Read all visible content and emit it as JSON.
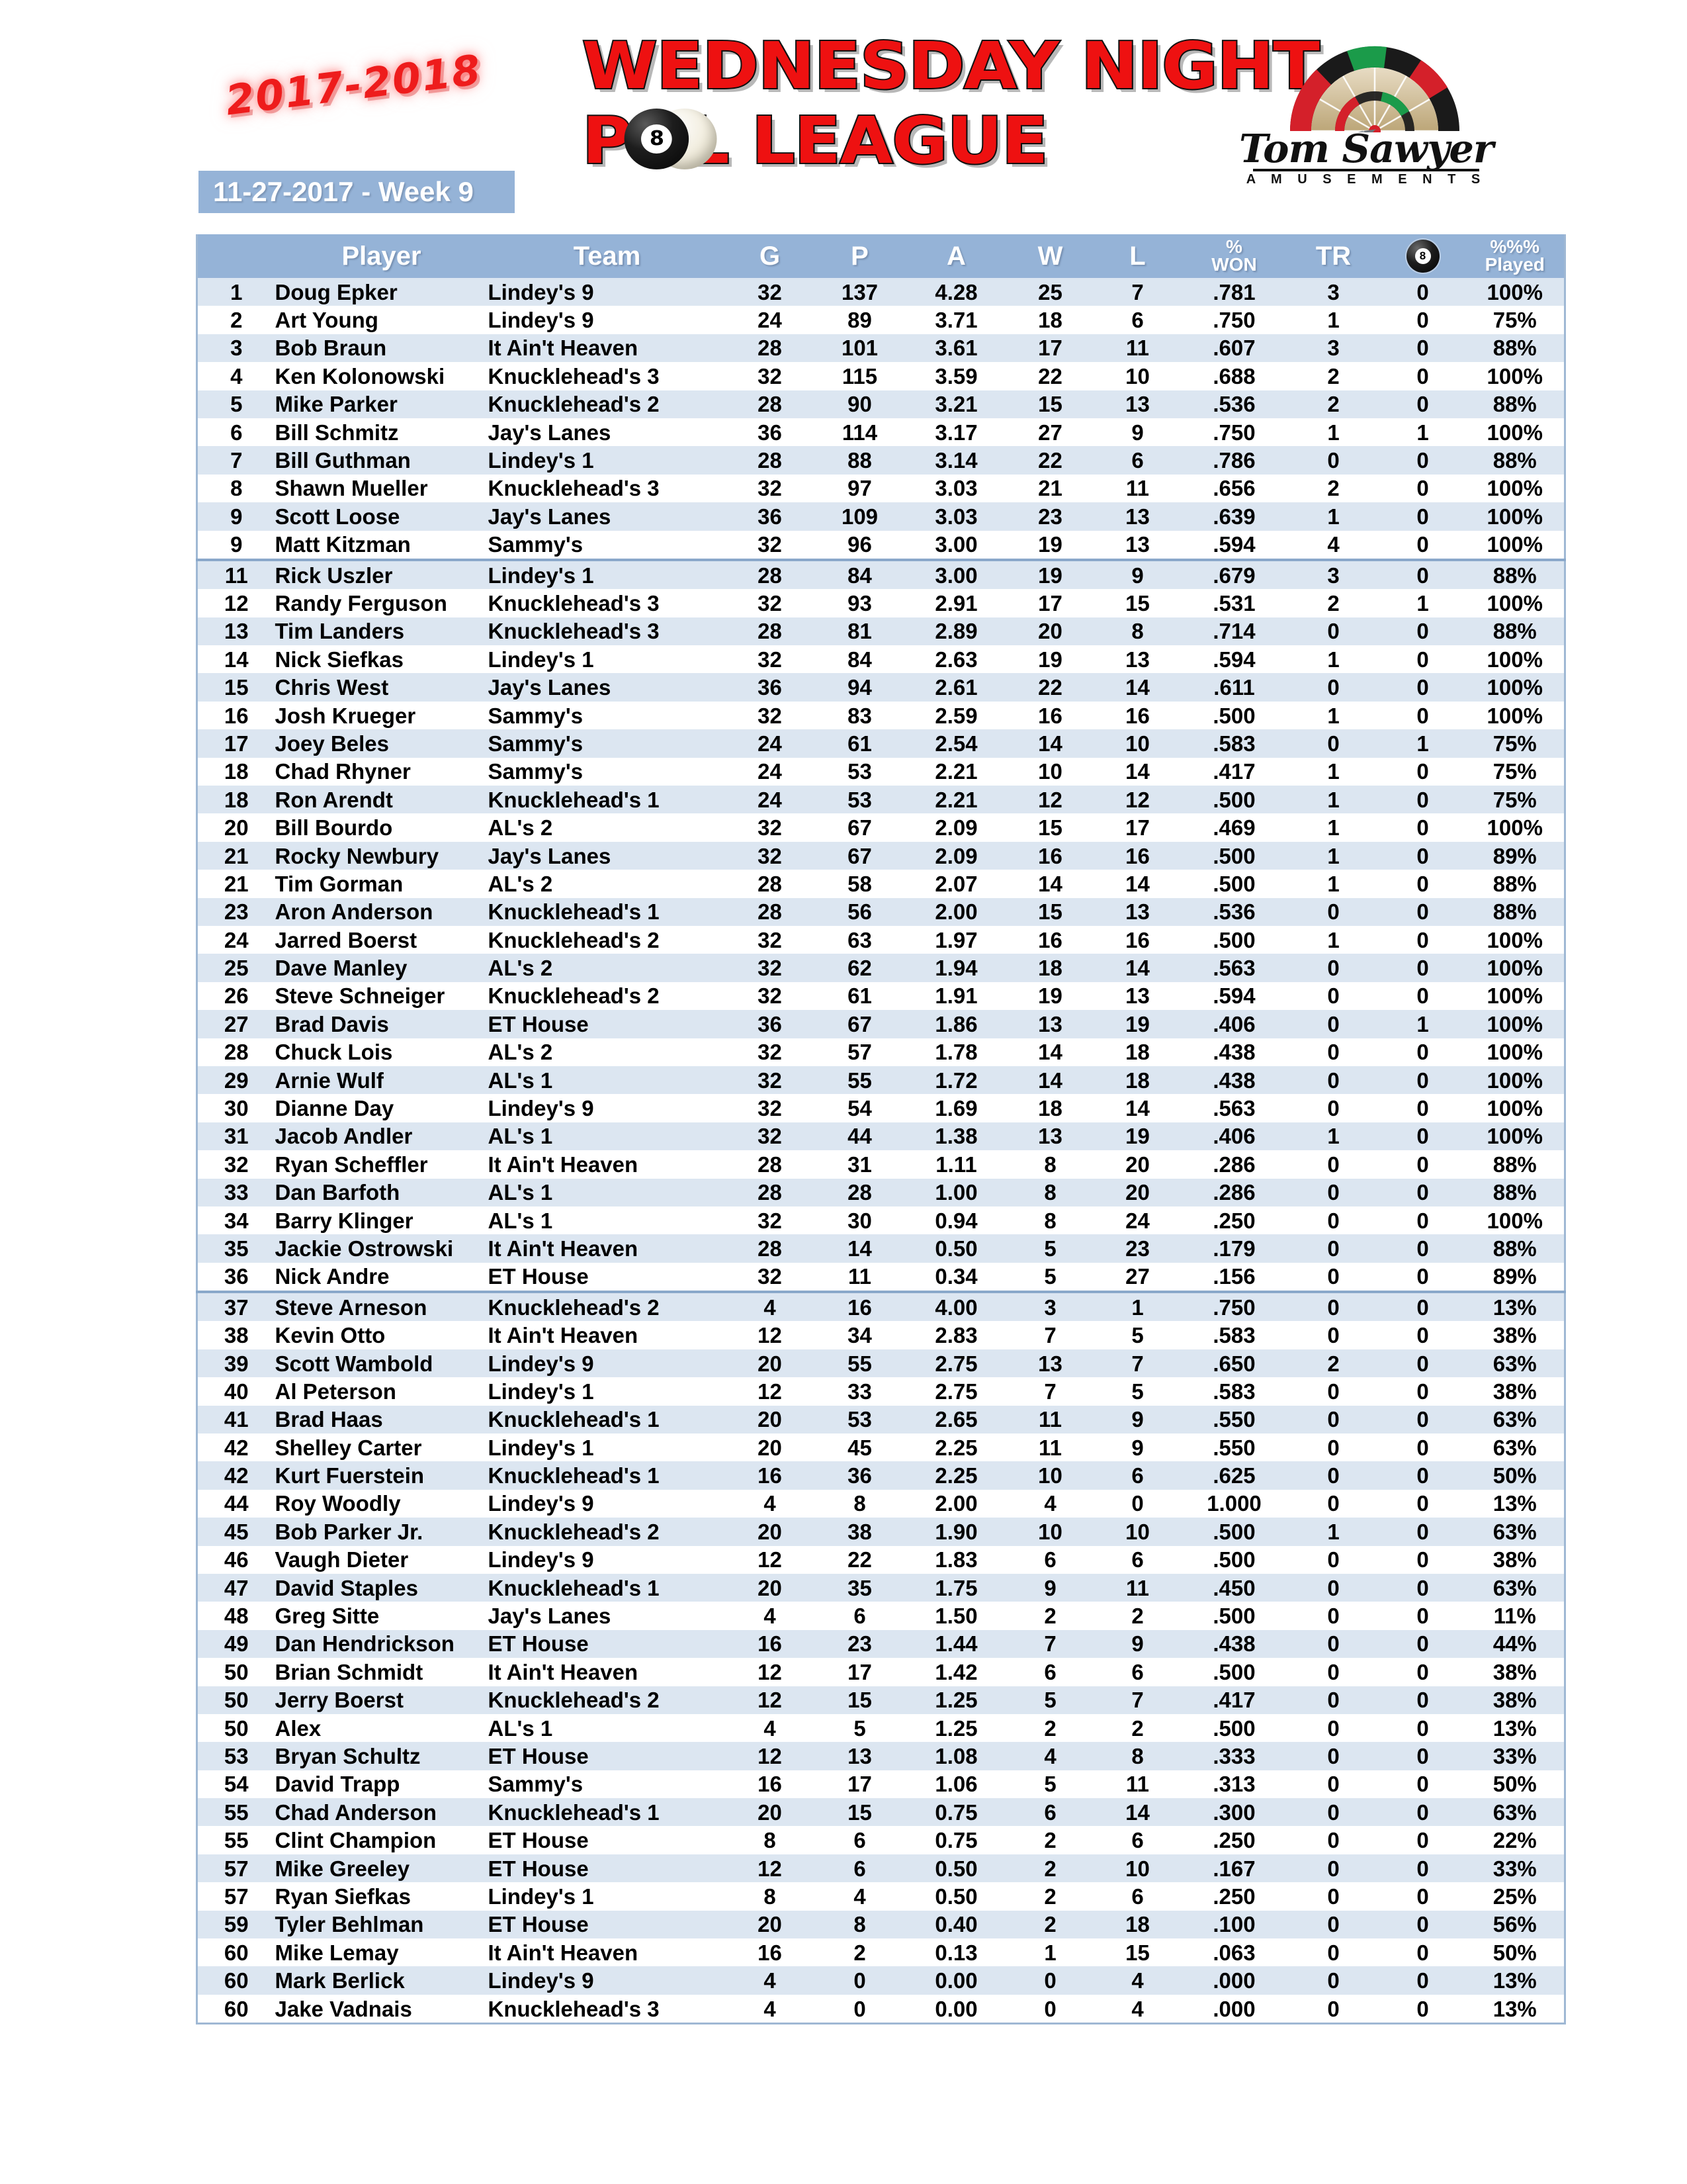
{
  "header": {
    "season": "2017-2018",
    "title_line1": "WEDNESDAY NIGHT",
    "title_line2_pre": "P",
    "title_line2_post": "L LEAGUE",
    "eight_ball_label": "8",
    "date_banner": "11-27-2017 - Week 9",
    "logo": {
      "name": "Tom Sawyer",
      "subtitle": "A M U S E M E N T S"
    },
    "colors": {
      "header_blue": "#95b3d7",
      "row_alt_blue": "#dce6f1",
      "title_red": "#ee1111",
      "border_blue": "#9fb8d4"
    }
  },
  "table": {
    "columns": [
      {
        "key": "rank",
        "label": ""
      },
      {
        "key": "player",
        "label": "Player"
      },
      {
        "key": "team",
        "label": "Team"
      },
      {
        "key": "g",
        "label": "G"
      },
      {
        "key": "p",
        "label": "P"
      },
      {
        "key": "a",
        "label": "A"
      },
      {
        "key": "w",
        "label": "W"
      },
      {
        "key": "l",
        "label": "L"
      },
      {
        "key": "won",
        "label_top": "%",
        "label_bot": "WON"
      },
      {
        "key": "tr",
        "label": "TR"
      },
      {
        "key": "eight",
        "label": "8-ball-icon"
      },
      {
        "key": "played",
        "label_top": "%%%",
        "label_bot": "Played"
      }
    ],
    "rows": [
      {
        "rank": "1",
        "player": "Doug Epker",
        "team": "Lindey's 9",
        "g": "32",
        "p": "137",
        "a": "4.28",
        "w": "25",
        "l": "7",
        "won": ".781",
        "tr": "3",
        "eight": "0",
        "played": "100%"
      },
      {
        "rank": "2",
        "player": "Art Young",
        "team": "Lindey's 9",
        "g": "24",
        "p": "89",
        "a": "3.71",
        "w": "18",
        "l": "6",
        "won": ".750",
        "tr": "1",
        "eight": "0",
        "played": "75%"
      },
      {
        "rank": "3",
        "player": "Bob Braun",
        "team": "It Ain't Heaven",
        "g": "28",
        "p": "101",
        "a": "3.61",
        "w": "17",
        "l": "11",
        "won": ".607",
        "tr": "3",
        "eight": "0",
        "played": "88%"
      },
      {
        "rank": "4",
        "player": "Ken Kolonowski",
        "team": "Knucklehead's 3",
        "g": "32",
        "p": "115",
        "a": "3.59",
        "w": "22",
        "l": "10",
        "won": ".688",
        "tr": "2",
        "eight": "0",
        "played": "100%"
      },
      {
        "rank": "5",
        "player": "Mike Parker",
        "team": "Knucklehead's 2",
        "g": "28",
        "p": "90",
        "a": "3.21",
        "w": "15",
        "l": "13",
        "won": ".536",
        "tr": "2",
        "eight": "0",
        "played": "88%"
      },
      {
        "rank": "6",
        "player": "Bill Schmitz",
        "team": "Jay's Lanes",
        "g": "36",
        "p": "114",
        "a": "3.17",
        "w": "27",
        "l": "9",
        "won": ".750",
        "tr": "1",
        "eight": "1",
        "played": "100%"
      },
      {
        "rank": "7",
        "player": "Bill Guthman",
        "team": "Lindey's 1",
        "g": "28",
        "p": "88",
        "a": "3.14",
        "w": "22",
        "l": "6",
        "won": ".786",
        "tr": "0",
        "eight": "0",
        "played": "88%"
      },
      {
        "rank": "8",
        "player": "Shawn Mueller",
        "team": "Knucklehead's 3",
        "g": "32",
        "p": "97",
        "a": "3.03",
        "w": "21",
        "l": "11",
        "won": ".656",
        "tr": "2",
        "eight": "0",
        "played": "100%"
      },
      {
        "rank": "9",
        "player": "Scott Loose",
        "team": "Jay's Lanes",
        "g": "36",
        "p": "109",
        "a": "3.03",
        "w": "23",
        "l": "13",
        "won": ".639",
        "tr": "1",
        "eight": "0",
        "played": "100%"
      },
      {
        "rank": "9",
        "player": "Matt Kitzman",
        "team": "Sammy's",
        "g": "32",
        "p": "96",
        "a": "3.00",
        "w": "19",
        "l": "13",
        "won": ".594",
        "tr": "4",
        "eight": "0",
        "played": "100%",
        "section_end": true
      },
      {
        "rank": "11",
        "player": "Rick Uszler",
        "team": "Lindey's 1",
        "g": "28",
        "p": "84",
        "a": "3.00",
        "w": "19",
        "l": "9",
        "won": ".679",
        "tr": "3",
        "eight": "0",
        "played": "88%"
      },
      {
        "rank": "12",
        "player": "Randy Ferguson",
        "team": "Knucklehead's 3",
        "g": "32",
        "p": "93",
        "a": "2.91",
        "w": "17",
        "l": "15",
        "won": ".531",
        "tr": "2",
        "eight": "1",
        "played": "100%"
      },
      {
        "rank": "13",
        "player": "Tim Landers",
        "team": "Knucklehead's 3",
        "g": "28",
        "p": "81",
        "a": "2.89",
        "w": "20",
        "l": "8",
        "won": ".714",
        "tr": "0",
        "eight": "0",
        "played": "88%"
      },
      {
        "rank": "14",
        "player": "Nick Siefkas",
        "team": "Lindey's 1",
        "g": "32",
        "p": "84",
        "a": "2.63",
        "w": "19",
        "l": "13",
        "won": ".594",
        "tr": "1",
        "eight": "0",
        "played": "100%"
      },
      {
        "rank": "15",
        "player": "Chris West",
        "team": "Jay's Lanes",
        "g": "36",
        "p": "94",
        "a": "2.61",
        "w": "22",
        "l": "14",
        "won": ".611",
        "tr": "0",
        "eight": "0",
        "played": "100%"
      },
      {
        "rank": "16",
        "player": "Josh Krueger",
        "team": "Sammy's",
        "g": "32",
        "p": "83",
        "a": "2.59",
        "w": "16",
        "l": "16",
        "won": ".500",
        "tr": "1",
        "eight": "0",
        "played": "100%"
      },
      {
        "rank": "17",
        "player": "Joey Beles",
        "team": "Sammy's",
        "g": "24",
        "p": "61",
        "a": "2.54",
        "w": "14",
        "l": "10",
        "won": ".583",
        "tr": "0",
        "eight": "1",
        "played": "75%"
      },
      {
        "rank": "18",
        "player": "Chad Rhyner",
        "team": "Sammy's",
        "g": "24",
        "p": "53",
        "a": "2.21",
        "w": "10",
        "l": "14",
        "won": ".417",
        "tr": "1",
        "eight": "0",
        "played": "75%"
      },
      {
        "rank": "18",
        "player": "Ron Arendt",
        "team": "Knucklehead's 1",
        "g": "24",
        "p": "53",
        "a": "2.21",
        "w": "12",
        "l": "12",
        "won": ".500",
        "tr": "1",
        "eight": "0",
        "played": "75%"
      },
      {
        "rank": "20",
        "player": "Bill Bourdo",
        "team": "AL's 2",
        "g": "32",
        "p": "67",
        "a": "2.09",
        "w": "15",
        "l": "17",
        "won": ".469",
        "tr": "1",
        "eight": "0",
        "played": "100%"
      },
      {
        "rank": "21",
        "player": "Rocky Newbury",
        "team": "Jay's Lanes",
        "g": "32",
        "p": "67",
        "a": "2.09",
        "w": "16",
        "l": "16",
        "won": ".500",
        "tr": "1",
        "eight": "0",
        "played": "89%"
      },
      {
        "rank": "21",
        "player": "Tim Gorman",
        "team": "AL's 2",
        "g": "28",
        "p": "58",
        "a": "2.07",
        "w": "14",
        "l": "14",
        "won": ".500",
        "tr": "1",
        "eight": "0",
        "played": "88%"
      },
      {
        "rank": "23",
        "player": "Aron Anderson",
        "team": "Knucklehead's 1",
        "g": "28",
        "p": "56",
        "a": "2.00",
        "w": "15",
        "l": "13",
        "won": ".536",
        "tr": "0",
        "eight": "0",
        "played": "88%"
      },
      {
        "rank": "24",
        "player": "Jarred Boerst",
        "team": "Knucklehead's 2",
        "g": "32",
        "p": "63",
        "a": "1.97",
        "w": "16",
        "l": "16",
        "won": ".500",
        "tr": "1",
        "eight": "0",
        "played": "100%"
      },
      {
        "rank": "25",
        "player": "Dave Manley",
        "team": "AL's 2",
        "g": "32",
        "p": "62",
        "a": "1.94",
        "w": "18",
        "l": "14",
        "won": ".563",
        "tr": "0",
        "eight": "0",
        "played": "100%"
      },
      {
        "rank": "26",
        "player": "Steve Schneiger",
        "team": "Knucklehead's 2",
        "g": "32",
        "p": "61",
        "a": "1.91",
        "w": "19",
        "l": "13",
        "won": ".594",
        "tr": "0",
        "eight": "0",
        "played": "100%"
      },
      {
        "rank": "27",
        "player": "Brad Davis",
        "team": "ET House",
        "g": "36",
        "p": "67",
        "a": "1.86",
        "w": "13",
        "l": "19",
        "won": ".406",
        "tr": "0",
        "eight": "1",
        "played": "100%"
      },
      {
        "rank": "28",
        "player": "Chuck Lois",
        "team": "AL's 2",
        "g": "32",
        "p": "57",
        "a": "1.78",
        "w": "14",
        "l": "18",
        "won": ".438",
        "tr": "0",
        "eight": "0",
        "played": "100%"
      },
      {
        "rank": "29",
        "player": "Arnie Wulf",
        "team": "AL's 1",
        "g": "32",
        "p": "55",
        "a": "1.72",
        "w": "14",
        "l": "18",
        "won": ".438",
        "tr": "0",
        "eight": "0",
        "played": "100%"
      },
      {
        "rank": "30",
        "player": "Dianne Day",
        "team": "Lindey's 9",
        "g": "32",
        "p": "54",
        "a": "1.69",
        "w": "18",
        "l": "14",
        "won": ".563",
        "tr": "0",
        "eight": "0",
        "played": "100%"
      },
      {
        "rank": "31",
        "player": "Jacob Andler",
        "team": "AL's 1",
        "g": "32",
        "p": "44",
        "a": "1.38",
        "w": "13",
        "l": "19",
        "won": ".406",
        "tr": "1",
        "eight": "0",
        "played": "100%"
      },
      {
        "rank": "32",
        "player": "Ryan Scheffler",
        "team": "It Ain't Heaven",
        "g": "28",
        "p": "31",
        "a": "1.11",
        "w": "8",
        "l": "20",
        "won": ".286",
        "tr": "0",
        "eight": "0",
        "played": "88%"
      },
      {
        "rank": "33",
        "player": "Dan Barfoth",
        "team": "AL's 1",
        "g": "28",
        "p": "28",
        "a": "1.00",
        "w": "8",
        "l": "20",
        "won": ".286",
        "tr": "0",
        "eight": "0",
        "played": "88%"
      },
      {
        "rank": "34",
        "player": "Barry Klinger",
        "team": "AL's 1",
        "g": "32",
        "p": "30",
        "a": "0.94",
        "w": "8",
        "l": "24",
        "won": ".250",
        "tr": "0",
        "eight": "0",
        "played": "100%"
      },
      {
        "rank": "35",
        "player": "Jackie Ostrowski",
        "team": "It Ain't Heaven",
        "g": "28",
        "p": "14",
        "a": "0.50",
        "w": "5",
        "l": "23",
        "won": ".179",
        "tr": "0",
        "eight": "0",
        "played": "88%"
      },
      {
        "rank": "36",
        "player": "Nick Andre",
        "team": "ET House",
        "g": "32",
        "p": "11",
        "a": "0.34",
        "w": "5",
        "l": "27",
        "won": ".156",
        "tr": "0",
        "eight": "0",
        "played": "89%",
        "section_end": true
      },
      {
        "rank": "37",
        "player": "Steve Arneson",
        "team": "Knucklehead's 2",
        "g": "4",
        "p": "16",
        "a": "4.00",
        "w": "3",
        "l": "1",
        "won": ".750",
        "tr": "0",
        "eight": "0",
        "played": "13%"
      },
      {
        "rank": "38",
        "player": "Kevin Otto",
        "team": "It Ain't Heaven",
        "g": "12",
        "p": "34",
        "a": "2.83",
        "w": "7",
        "l": "5",
        "won": ".583",
        "tr": "0",
        "eight": "0",
        "played": "38%"
      },
      {
        "rank": "39",
        "player": "Scott Wambold",
        "team": "Lindey's 9",
        "g": "20",
        "p": "55",
        "a": "2.75",
        "w": "13",
        "l": "7",
        "won": ".650",
        "tr": "2",
        "eight": "0",
        "played": "63%"
      },
      {
        "rank": "40",
        "player": "Al Peterson",
        "team": "Lindey's 1",
        "g": "12",
        "p": "33",
        "a": "2.75",
        "w": "7",
        "l": "5",
        "won": ".583",
        "tr": "0",
        "eight": "0",
        "played": "38%"
      },
      {
        "rank": "41",
        "player": "Brad Haas",
        "team": "Knucklehead's 1",
        "g": "20",
        "p": "53",
        "a": "2.65",
        "w": "11",
        "l": "9",
        "won": ".550",
        "tr": "0",
        "eight": "0",
        "played": "63%"
      },
      {
        "rank": "42",
        "player": "Shelley Carter",
        "team": "Lindey's 1",
        "g": "20",
        "p": "45",
        "a": "2.25",
        "w": "11",
        "l": "9",
        "won": ".550",
        "tr": "0",
        "eight": "0",
        "played": "63%"
      },
      {
        "rank": "42",
        "player": "Kurt Fuerstein",
        "team": "Knucklehead's 1",
        "g": "16",
        "p": "36",
        "a": "2.25",
        "w": "10",
        "l": "6",
        "won": ".625",
        "tr": "0",
        "eight": "0",
        "played": "50%"
      },
      {
        "rank": "44",
        "player": "Roy Woodly",
        "team": "Lindey's 9",
        "g": "4",
        "p": "8",
        "a": "2.00",
        "w": "4",
        "l": "0",
        "won": "1.000",
        "tr": "0",
        "eight": "0",
        "played": "13%"
      },
      {
        "rank": "45",
        "player": "Bob Parker Jr.",
        "team": "Knucklehead's 2",
        "g": "20",
        "p": "38",
        "a": "1.90",
        "w": "10",
        "l": "10",
        "won": ".500",
        "tr": "1",
        "eight": "0",
        "played": "63%"
      },
      {
        "rank": "46",
        "player": "Vaugh Dieter",
        "team": "Lindey's 9",
        "g": "12",
        "p": "22",
        "a": "1.83",
        "w": "6",
        "l": "6",
        "won": ".500",
        "tr": "0",
        "eight": "0",
        "played": "38%"
      },
      {
        "rank": "47",
        "player": "David Staples",
        "team": "Knucklehead's 1",
        "g": "20",
        "p": "35",
        "a": "1.75",
        "w": "9",
        "l": "11",
        "won": ".450",
        "tr": "0",
        "eight": "0",
        "played": "63%"
      },
      {
        "rank": "48",
        "player": "Greg Sitte",
        "team": "Jay's Lanes",
        "g": "4",
        "p": "6",
        "a": "1.50",
        "w": "2",
        "l": "2",
        "won": ".500",
        "tr": "0",
        "eight": "0",
        "played": "11%"
      },
      {
        "rank": "49",
        "player": "Dan Hendrickson",
        "team": "ET House",
        "g": "16",
        "p": "23",
        "a": "1.44",
        "w": "7",
        "l": "9",
        "won": ".438",
        "tr": "0",
        "eight": "0",
        "played": "44%"
      },
      {
        "rank": "50",
        "player": "Brian Schmidt",
        "team": "It Ain't Heaven",
        "g": "12",
        "p": "17",
        "a": "1.42",
        "w": "6",
        "l": "6",
        "won": ".500",
        "tr": "0",
        "eight": "0",
        "played": "38%"
      },
      {
        "rank": "50",
        "player": "Jerry Boerst",
        "team": "Knucklehead's 2",
        "g": "12",
        "p": "15",
        "a": "1.25",
        "w": "5",
        "l": "7",
        "won": ".417",
        "tr": "0",
        "eight": "0",
        "played": "38%"
      },
      {
        "rank": "50",
        "player": "Alex",
        "team": "AL's 1",
        "g": "4",
        "p": "5",
        "a": "1.25",
        "w": "2",
        "l": "2",
        "won": ".500",
        "tr": "0",
        "eight": "0",
        "played": "13%"
      },
      {
        "rank": "53",
        "player": "Bryan Schultz",
        "team": "ET House",
        "g": "12",
        "p": "13",
        "a": "1.08",
        "w": "4",
        "l": "8",
        "won": ".333",
        "tr": "0",
        "eight": "0",
        "played": "33%"
      },
      {
        "rank": "54",
        "player": "David Trapp",
        "team": "Sammy's",
        "g": "16",
        "p": "17",
        "a": "1.06",
        "w": "5",
        "l": "11",
        "won": ".313",
        "tr": "0",
        "eight": "0",
        "played": "50%"
      },
      {
        "rank": "55",
        "player": "Chad Anderson",
        "team": "Knucklehead's 1",
        "g": "20",
        "p": "15",
        "a": "0.75",
        "w": "6",
        "l": "14",
        "won": ".300",
        "tr": "0",
        "eight": "0",
        "played": "63%"
      },
      {
        "rank": "55",
        "player": "Clint Champion",
        "team": "ET House",
        "g": "8",
        "p": "6",
        "a": "0.75",
        "w": "2",
        "l": "6",
        "won": ".250",
        "tr": "0",
        "eight": "0",
        "played": "22%"
      },
      {
        "rank": "57",
        "player": "Mike Greeley",
        "team": "ET House",
        "g": "12",
        "p": "6",
        "a": "0.50",
        "w": "2",
        "l": "10",
        "won": ".167",
        "tr": "0",
        "eight": "0",
        "played": "33%"
      },
      {
        "rank": "57",
        "player": "Ryan Siefkas",
        "team": "Lindey's 1",
        "g": "8",
        "p": "4",
        "a": "0.50",
        "w": "2",
        "l": "6",
        "won": ".250",
        "tr": "0",
        "eight": "0",
        "played": "25%"
      },
      {
        "rank": "59",
        "player": "Tyler Behlman",
        "team": "ET House",
        "g": "20",
        "p": "8",
        "a": "0.40",
        "w": "2",
        "l": "18",
        "won": ".100",
        "tr": "0",
        "eight": "0",
        "played": "56%"
      },
      {
        "rank": "60",
        "player": "Mike Lemay",
        "team": "It Ain't Heaven",
        "g": "16",
        "p": "2",
        "a": "0.13",
        "w": "1",
        "l": "15",
        "won": ".063",
        "tr": "0",
        "eight": "0",
        "played": "50%"
      },
      {
        "rank": "60",
        "player": "Mark Berlick",
        "team": "Lindey's 9",
        "g": "4",
        "p": "0",
        "a": "0.00",
        "w": "0",
        "l": "4",
        "won": ".000",
        "tr": "0",
        "eight": "0",
        "played": "13%"
      },
      {
        "rank": "60",
        "player": "Jake Vadnais",
        "team": "Knucklehead's 3",
        "g": "4",
        "p": "0",
        "a": "0.00",
        "w": "0",
        "l": "4",
        "won": ".000",
        "tr": "0",
        "eight": "0",
        "played": "13%"
      }
    ]
  }
}
